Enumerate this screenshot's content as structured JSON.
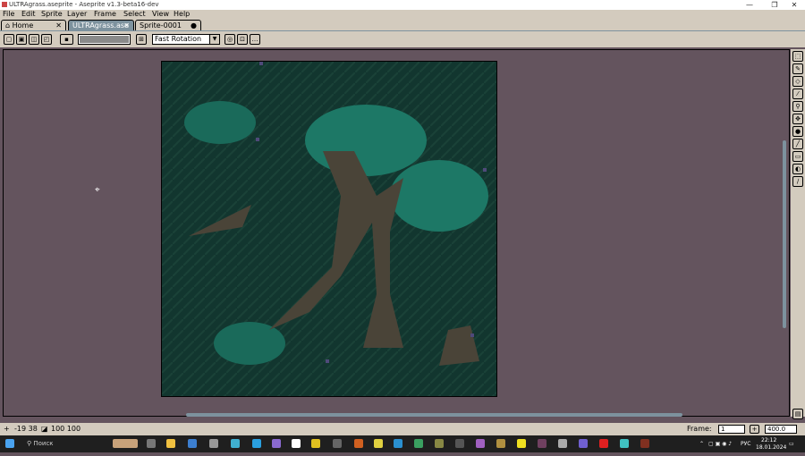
{
  "window": {
    "title": "ULTRAgrass.aseprite - Aseprite v1.3-beta16-dev",
    "min": "—",
    "max": "❐",
    "close": "✕"
  },
  "menu": [
    "File",
    "Edit",
    "Sprite",
    "Layer",
    "Frame",
    "Select",
    "View",
    "Help"
  ],
  "tabs": [
    {
      "label": "Home",
      "icon": "home-icon",
      "close": "✕"
    },
    {
      "label": "ULTRAgrass.ase",
      "close": "✕",
      "active": true
    },
    {
      "label": "Sprite-0001",
      "modified": "●"
    }
  ],
  "context_bar": {
    "slider_label": "",
    "rotation_algorithm": "Fast Rotation"
  },
  "status": {
    "coords": "-19 38",
    "size": "100 100"
  },
  "frame": {
    "label": "Frame:",
    "value": "1",
    "zoom": "400.0"
  },
  "taskbar": {
    "search_placeholder": "Поиск",
    "lang": "РУС",
    "time": "22:12",
    "date": "18.01.2024"
  },
  "colors": {
    "canvas_bg": "#12362f",
    "workspace": "#64545e",
    "panel": "#d3cbbe",
    "accent": "#7d929e",
    "teal": "#1a6a5a",
    "trunk": "#4a4438"
  }
}
